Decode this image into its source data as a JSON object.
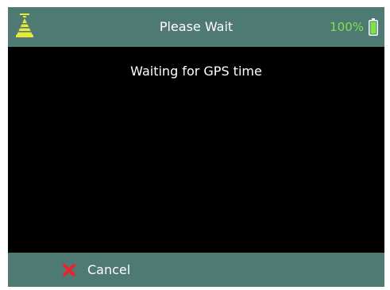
{
  "title_bar": {
    "title": "Please Wait",
    "battery_percent": "100%",
    "battery_level": 1.0,
    "gps_icon": "gps-signal-icon",
    "battery_icon": "battery-icon"
  },
  "main": {
    "status_message": "Waiting for GPS time"
  },
  "footer": {
    "cancel_label": "Cancel",
    "cancel_icon": "red-x-icon"
  },
  "colors": {
    "bar_background": "#4f7a74",
    "screen_background": "#000000",
    "battery_green": "#7ee34a",
    "gps_icon_yellow": "#e8e83a",
    "cancel_red": "#e8242b",
    "text": "#ffffff"
  }
}
